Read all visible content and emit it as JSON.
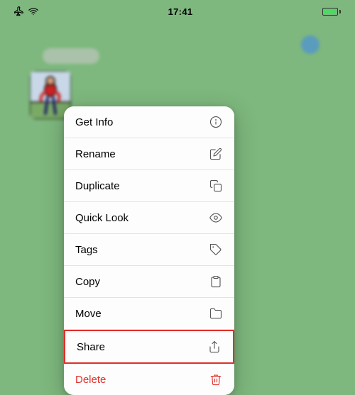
{
  "statusBar": {
    "time": "17:41",
    "airplaneMode": true,
    "wifi": true
  },
  "menu": {
    "items": [
      {
        "id": "get-info",
        "label": "Get Info",
        "icon": "info"
      },
      {
        "id": "rename",
        "label": "Rename",
        "icon": "rename"
      },
      {
        "id": "duplicate",
        "label": "Duplicate",
        "icon": "duplicate"
      },
      {
        "id": "quick-look",
        "label": "Quick Look",
        "icon": "quicklook"
      },
      {
        "id": "tags",
        "label": "Tags",
        "icon": "tags"
      },
      {
        "id": "copy",
        "label": "Copy",
        "icon": "copy"
      },
      {
        "id": "move",
        "label": "Move",
        "icon": "move"
      },
      {
        "id": "share",
        "label": "Share",
        "icon": "share",
        "highlighted": true
      },
      {
        "id": "delete",
        "label": "Delete",
        "icon": "delete",
        "danger": true
      }
    ]
  }
}
